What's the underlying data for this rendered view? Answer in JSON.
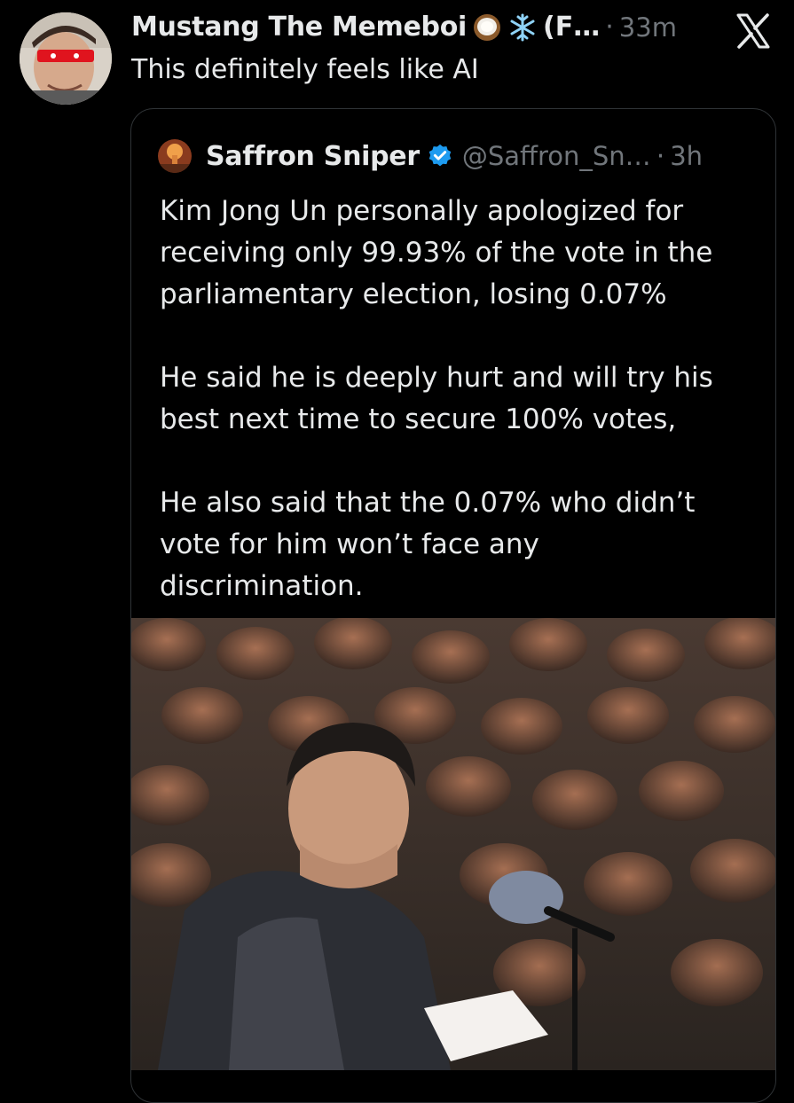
{
  "post": {
    "author_name": "Mustang The Memeboi",
    "name_suffix": "(F…",
    "separator": "·",
    "time": "33m",
    "text": "This definitely feels like AI",
    "emoji": [
      "coconut-emoji",
      "snowflake-emoji"
    ],
    "close_icon": "x-logo-icon"
  },
  "quote": {
    "author_name": "Saffron Sniper",
    "verified_icon": "verified-badge-icon",
    "handle": "@Saffron_Sn…",
    "separator": "·",
    "time": "3h",
    "paragraphs": [
      "Kim Jong Un personally apologized for\nreceiving only 99.93% of the vote in the\nparliamentary election, losing 0.07%",
      "He said he is deeply hurt and will try his\nbest next time to secure 100% votes,",
      "He also said that the 0.07% who didn’t\nvote for him won’t face any\ndiscrimination."
    ]
  },
  "colors": {
    "background": "#000000",
    "text_primary": "#e7e9ea",
    "text_secondary": "#71767b",
    "border": "#2f3336",
    "verified_blue": "#1d9bf0"
  }
}
